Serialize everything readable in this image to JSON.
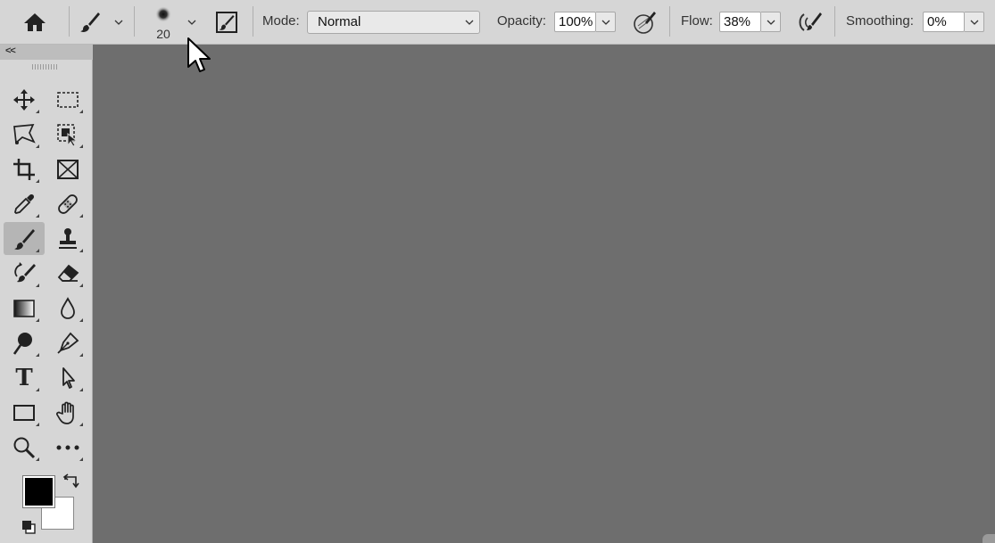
{
  "optionsbar": {
    "brush_size": "20",
    "mode_label": "Mode:",
    "mode_value": "Normal",
    "opacity_label": "Opacity:",
    "opacity_value": "100%",
    "flow_label": "Flow:",
    "flow_value": "38%",
    "smoothing_label": "Smoothing:",
    "smoothing_value": "0%"
  },
  "toolbar": {
    "collapse_glyph": "<<",
    "tools": [
      "move-tool",
      "rectangular-marquee-tool",
      "polygonal-lasso-tool",
      "object-selection-tool",
      "crop-tool",
      "frame-tool",
      "eyedropper-tool",
      "spot-healing-tool",
      "brush-tool",
      "clone-stamp-tool",
      "history-brush-tool",
      "eraser-tool",
      "gradient-tool",
      "blur-tool",
      "dodge-tool",
      "pen-tool",
      "type-tool",
      "path-selection-tool",
      "rectangle-tool",
      "hand-tool",
      "zoom-tool",
      "edit-toolbar"
    ],
    "type_glyph": "T",
    "foreground_color": "#000000",
    "background_color": "#ffffff",
    "active_tool": "brush-tool"
  },
  "colors": {
    "ui_panel": "#d6d6d6",
    "canvas_area": "#6e6e6e",
    "active_tool_bg": "#b5b5b5"
  }
}
